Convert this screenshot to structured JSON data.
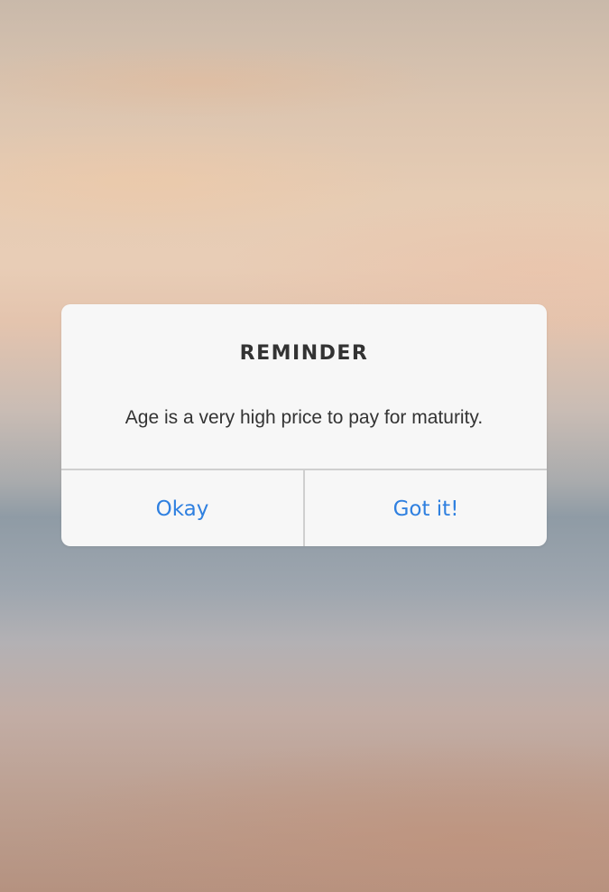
{
  "dialog": {
    "title": "REMINDER",
    "message": "Age is a very high price to pay for maturity.",
    "buttons": {
      "primary_label": "Okay",
      "secondary_label": "Got it!"
    }
  },
  "colors": {
    "button_text": "#2f80e0",
    "title_text": "#333333",
    "dialog_background": "#f7f7f7",
    "divider": "#cfcfcf"
  }
}
